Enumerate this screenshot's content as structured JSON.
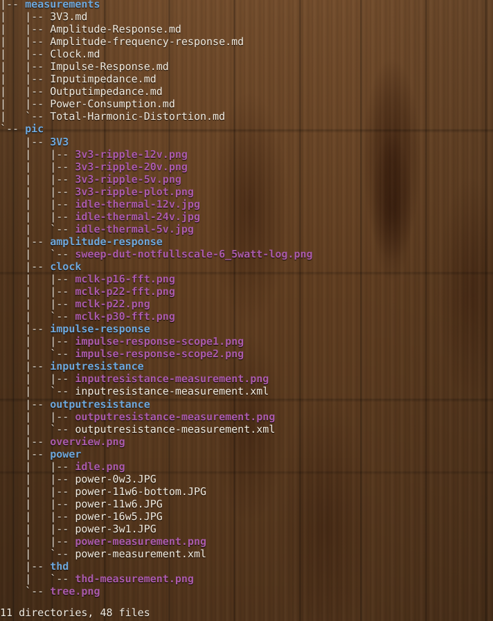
{
  "window": {
    "type": "terminal",
    "command": "tree",
    "transparent_background": true,
    "wallpaper": "wood-planks"
  },
  "colors": {
    "wallpaper_base": "#6a4424",
    "directory": "#6fa8dc",
    "image_file": "#ab5bab",
    "plain_file": "#f2ece1",
    "tree_glyph": "#e8e0d4"
  },
  "tree": {
    "lines": [
      {
        "prefix": "|-- ",
        "name": "measurements",
        "kind": "dir"
      },
      {
        "prefix": "|   |-- ",
        "name": "3V3.md",
        "kind": "file"
      },
      {
        "prefix": "|   |-- ",
        "name": "Amplitude-Response.md",
        "kind": "file"
      },
      {
        "prefix": "|   |-- ",
        "name": "Amplitude-frequency-response.md",
        "kind": "file"
      },
      {
        "prefix": "|   |-- ",
        "name": "Clock.md",
        "kind": "file"
      },
      {
        "prefix": "|   |-- ",
        "name": "Impulse-Response.md",
        "kind": "file"
      },
      {
        "prefix": "|   |-- ",
        "name": "Inputimpedance.md",
        "kind": "file"
      },
      {
        "prefix": "|   |-- ",
        "name": "Outputimpedance.md",
        "kind": "file"
      },
      {
        "prefix": "|   |-- ",
        "name": "Power-Consumption.md",
        "kind": "file"
      },
      {
        "prefix": "|   `-- ",
        "name": "Total-Harmonic-Distortion.md",
        "kind": "file"
      },
      {
        "prefix": "`-- ",
        "name": "pic",
        "kind": "dir"
      },
      {
        "prefix": "    |-- ",
        "name": "3V3",
        "kind": "dir"
      },
      {
        "prefix": "    |   |-- ",
        "name": "3v3-ripple-12v.png",
        "kind": "image"
      },
      {
        "prefix": "    |   |-- ",
        "name": "3v3-ripple-20v.png",
        "kind": "image"
      },
      {
        "prefix": "    |   |-- ",
        "name": "3v3-ripple-5v.png",
        "kind": "image"
      },
      {
        "prefix": "    |   |-- ",
        "name": "3v3-ripple-plot.png",
        "kind": "image"
      },
      {
        "prefix": "    |   |-- ",
        "name": "idle-thermal-12v.jpg",
        "kind": "image"
      },
      {
        "prefix": "    |   |-- ",
        "name": "idle-thermal-24v.jpg",
        "kind": "image"
      },
      {
        "prefix": "    |   `-- ",
        "name": "idle-thermal-5v.jpg",
        "kind": "image"
      },
      {
        "prefix": "    |-- ",
        "name": "amplitude-response",
        "kind": "dir"
      },
      {
        "prefix": "    |   `-- ",
        "name": "sweep-dut-notfullscale-6_5watt-log.png",
        "kind": "image"
      },
      {
        "prefix": "    |-- ",
        "name": "clock",
        "kind": "dir"
      },
      {
        "prefix": "    |   |-- ",
        "name": "mclk-p16-fft.png",
        "kind": "image"
      },
      {
        "prefix": "    |   |-- ",
        "name": "mclk-p22-fft.png",
        "kind": "image"
      },
      {
        "prefix": "    |   |-- ",
        "name": "mclk-p22.png",
        "kind": "image"
      },
      {
        "prefix": "    |   `-- ",
        "name": "mclk-p30-fft.png",
        "kind": "image"
      },
      {
        "prefix": "    |-- ",
        "name": "impulse-response",
        "kind": "dir"
      },
      {
        "prefix": "    |   |-- ",
        "name": "impulse-response-scope1.png",
        "kind": "image"
      },
      {
        "prefix": "    |   `-- ",
        "name": "impulse-response-scope2.png",
        "kind": "image"
      },
      {
        "prefix": "    |-- ",
        "name": "inputresistance",
        "kind": "dir"
      },
      {
        "prefix": "    |   |-- ",
        "name": "inputresistance-measurement.png",
        "kind": "image"
      },
      {
        "prefix": "    |   `-- ",
        "name": "inputresistance-measurement.xml",
        "kind": "file"
      },
      {
        "prefix": "    |-- ",
        "name": "outputresistance",
        "kind": "dir"
      },
      {
        "prefix": "    |   |-- ",
        "name": "outputresistance-measurement.png",
        "kind": "image"
      },
      {
        "prefix": "    |   `-- ",
        "name": "outputresistance-measurement.xml",
        "kind": "file"
      },
      {
        "prefix": "    |-- ",
        "name": "overview.png",
        "kind": "image"
      },
      {
        "prefix": "    |-- ",
        "name": "power",
        "kind": "dir"
      },
      {
        "prefix": "    |   |-- ",
        "name": "idle.png",
        "kind": "image"
      },
      {
        "prefix": "    |   |-- ",
        "name": "power-0w3.JPG",
        "kind": "file"
      },
      {
        "prefix": "    |   |-- ",
        "name": "power-11w6-bottom.JPG",
        "kind": "file"
      },
      {
        "prefix": "    |   |-- ",
        "name": "power-11w6.JPG",
        "kind": "file"
      },
      {
        "prefix": "    |   |-- ",
        "name": "power-16w5.JPG",
        "kind": "file"
      },
      {
        "prefix": "    |   |-- ",
        "name": "power-3w1.JPG",
        "kind": "file"
      },
      {
        "prefix": "    |   |-- ",
        "name": "power-measurement.png",
        "kind": "image"
      },
      {
        "prefix": "    |   `-- ",
        "name": "power-measurement.xml",
        "kind": "file"
      },
      {
        "prefix": "    |-- ",
        "name": "thd",
        "kind": "dir"
      },
      {
        "prefix": "    |   `-- ",
        "name": "thd-measurement.png",
        "kind": "image"
      },
      {
        "prefix": "    `-- ",
        "name": "tree.png",
        "kind": "image"
      }
    ]
  },
  "summary": {
    "text": "11 directories, 48 files",
    "directories": 11,
    "files": 48
  }
}
